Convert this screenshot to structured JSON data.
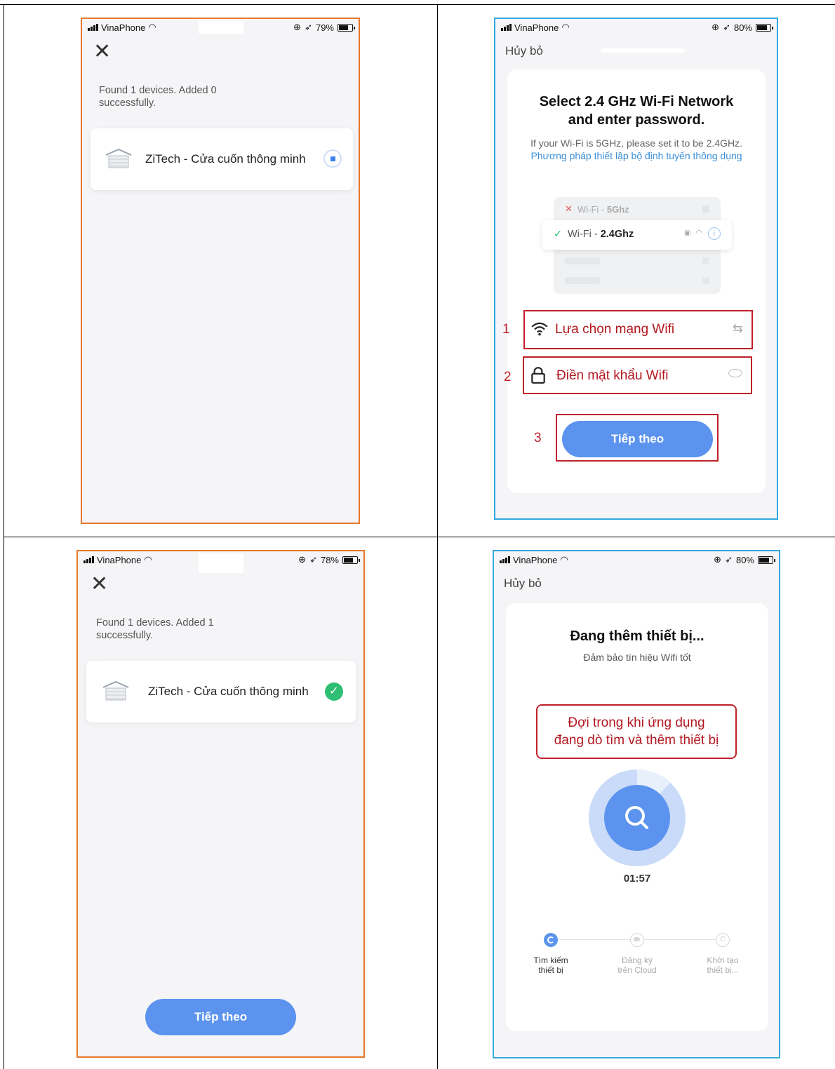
{
  "carrier": "VinaPhone",
  "colors": {
    "accent": "#5b93ee",
    "link": "#3a8ed8",
    "success": "#2fbf74",
    "annotation_red": "#c0202a",
    "frame_orange": "#e8772a",
    "frame_blue": "#34a8e0"
  },
  "panel1": {
    "battery": "79%",
    "battery_level": 0.79,
    "found_text": "Found 1 devices. Added 0 successfully.",
    "device_name": "ZiTech - Cửa cuốn thông minh",
    "status_icon": "loading-spinner-icon"
  },
  "panel2": {
    "battery": "80%",
    "battery_level": 0.8,
    "cancel": "Hủy bỏ",
    "title_line1": "Select 2.4 GHz Wi-Fi Network",
    "title_line2": "and enter password.",
    "hint_plain": "If your Wi-Fi is 5GHz, please set it to be 2.4GHz.",
    "hint_link": "Phương pháp thiết lập bộ định tuyến thông dụng",
    "wifi_5g_prefix": "Wi-Fi - ",
    "wifi_5g_band": "5Ghz",
    "wifi_24_prefix": "Wi-Fi - ",
    "wifi_24_band": "2.4Ghz",
    "step1_num": "1",
    "step1_label": "Lựa chọn mạng Wifi",
    "step2_num": "2",
    "step2_label": "Điền mật khẩu Wifi",
    "step3_num": "3",
    "next_button": "Tiếp theo"
  },
  "panel3": {
    "battery": "78%",
    "battery_level": 0.78,
    "found_text": "Found 1 devices. Added 1 successfully.",
    "device_name": "ZiTech - Cửa cuốn thông minh",
    "status_icon": "check-circle-icon",
    "next_button": "Tiếp theo"
  },
  "panel4": {
    "battery": "80%",
    "battery_level": 0.8,
    "cancel": "Hủy bỏ",
    "title": "Đang thêm thiết bị...",
    "subtitle": "Đảm bảo tín hiệu Wifi tốt",
    "note_line1": "Đợi trong khi ứng dụng",
    "note_line2": "đang dò tìm và thêm thiết bị",
    "timer": "01:57",
    "steps": [
      {
        "line1": "Tìm kiếm",
        "line2": "thiết bị",
        "active": true
      },
      {
        "line1": "Đăng ký",
        "line2": "trên Cloud",
        "active": false
      },
      {
        "line1": "Khởi tạo",
        "line2": "thiết bị...",
        "active": false
      }
    ]
  }
}
